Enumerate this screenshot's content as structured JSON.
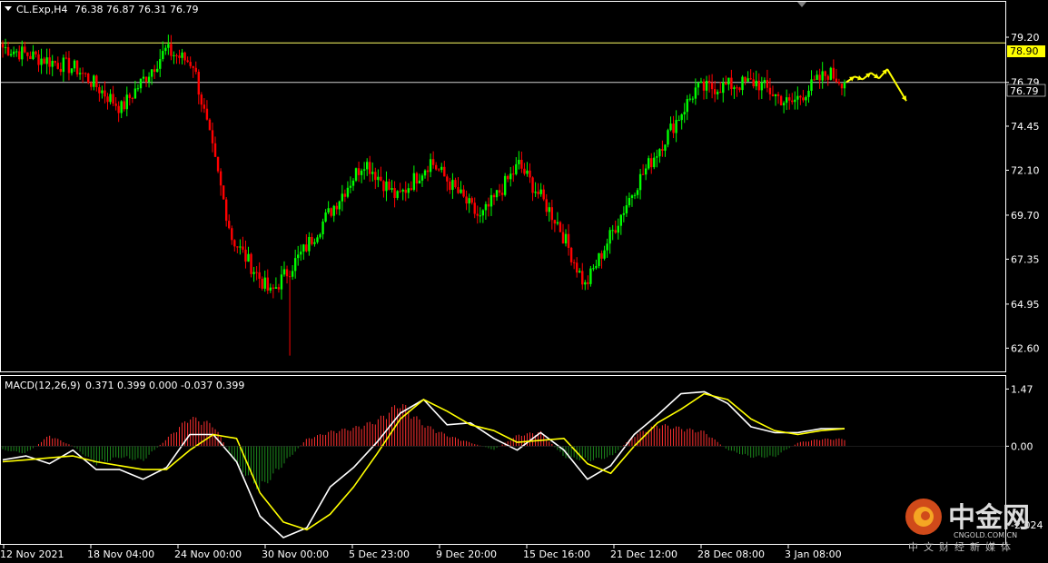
{
  "header": {
    "symbol_text": "CL.Exp,H4",
    "ohlc_text": "76.38 76.87 76.31 76.79"
  },
  "macd_header": {
    "label": "MACD(12,26,9)",
    "values_text": "0.371 0.399 0.000 -0.037 0.399"
  },
  "colors": {
    "background": "#000000",
    "bull_candle": "#00ff00",
    "bear_candle": "#ff0000",
    "grid_frame": "#ffffff",
    "level_line": "#ffff66",
    "macd_line": "#ffffff",
    "signal_line": "#ffff00",
    "hist_positive": "#ff3030",
    "hist_negative": "#1c8a1c",
    "arrow": "#ffff00"
  },
  "price_tags": {
    "level_top": "78.90",
    "current": "76.79"
  },
  "x_labels": [
    "12 Nov 2021",
    "18 Nov 04:00",
    "24 Nov 00:00",
    "30 Nov 00:00",
    "5 Dec 23:00",
    "9 Dec 20:00",
    "15 Dec 16:00",
    "21 Dec 12:00",
    "28 Dec 08:00",
    "3 Jan 08:00"
  ],
  "watermark": {
    "brand_cn": "中金网",
    "domain": "CNGOLD.COM.CN",
    "tagline_cn": "中文财经新媒体"
  },
  "chart_data": [
    {
      "type": "candlestick",
      "title": "CL.Exp,H4",
      "y_ticks": [
        "79.20",
        "76.79",
        "74.45",
        "72.10",
        "69.70",
        "67.35",
        "64.95",
        "62.60"
      ],
      "ylim": [
        61.6,
        80.8
      ],
      "horizontal_levels": [
        78.9,
        76.79
      ],
      "last_close": 76.79,
      "segments": [
        {
          "n": 28,
          "start": 78.7,
          "end": 77.5
        },
        {
          "n": 16,
          "start": 77.5,
          "end": 75.4
        },
        {
          "n": 16,
          "start": 75.4,
          "end": 78.5
        },
        {
          "n": 10,
          "start": 78.5,
          "end": 77.8
        },
        {
          "n": 14,
          "start": 77.8,
          "end": 68.5
        },
        {
          "n": 14,
          "start": 68.5,
          "end": 65.5
        },
        {
          "n": 12,
          "start": 65.5,
          "end": 67.8
        },
        {
          "n": 22,
          "start": 67.8,
          "end": 72.6
        },
        {
          "n": 12,
          "start": 72.6,
          "end": 70.6
        },
        {
          "n": 12,
          "start": 70.6,
          "end": 72.6
        },
        {
          "n": 18,
          "start": 72.6,
          "end": 69.5
        },
        {
          "n": 14,
          "start": 69.5,
          "end": 72.4
        },
        {
          "n": 14,
          "start": 72.4,
          "end": 69.3
        },
        {
          "n": 10,
          "start": 69.3,
          "end": 65.9
        },
        {
          "n": 18,
          "start": 65.9,
          "end": 71.2
        },
        {
          "n": 22,
          "start": 71.2,
          "end": 76.4
        },
        {
          "n": 22,
          "start": 76.4,
          "end": 76.8
        },
        {
          "n": 12,
          "start": 76.8,
          "end": 75.6
        },
        {
          "n": 14,
          "start": 75.6,
          "end": 77.3
        },
        {
          "n": 6,
          "start": 77.3,
          "end": 76.79
        }
      ],
      "low_spike": 62.2,
      "forecast_path": [
        76.8,
        77.1,
        76.95,
        77.3,
        77.0,
        77.5,
        75.8
      ]
    },
    {
      "type": "line",
      "title": "MACD(12,26,9)",
      "y_ticks": [
        "1.47",
        "0.00",
        "-2.024"
      ],
      "ylim": [
        -2.35,
        1.62
      ],
      "series": [
        {
          "name": "MACD",
          "color": "#ffffff",
          "values": [
            -0.35,
            -0.25,
            -0.45,
            -0.1,
            -0.6,
            -0.6,
            -0.85,
            -0.55,
            0.3,
            0.3,
            -0.4,
            -1.8,
            -2.35,
            -2.1,
            -1.05,
            -0.55,
            0.1,
            0.85,
            1.2,
            0.55,
            0.6,
            0.2,
            -0.1,
            0.35,
            -0.1,
            -0.85,
            -0.5,
            0.3,
            0.8,
            1.35,
            1.4,
            1.1,
            0.5,
            0.35,
            0.35,
            0.45,
            0.45
          ]
        },
        {
          "name": "Signal",
          "color": "#ffff00",
          "values": [
            -0.4,
            -0.35,
            -0.3,
            -0.25,
            -0.4,
            -0.5,
            -0.6,
            -0.6,
            -0.1,
            0.3,
            0.2,
            -1.2,
            -1.95,
            -2.15,
            -1.75,
            -1.05,
            -0.2,
            0.7,
            1.2,
            0.9,
            0.55,
            0.4,
            0.1,
            0.15,
            0.2,
            -0.45,
            -0.7,
            0.0,
            0.6,
            0.95,
            1.35,
            1.2,
            0.7,
            0.4,
            0.3,
            0.4,
            0.45
          ]
        }
      ],
      "histogram_profile": [
        -0.1,
        -0.2,
        0.3,
        0.0,
        -0.5,
        -0.3,
        -0.4,
        0.2,
        0.8,
        0.6,
        -0.5,
        -1.2,
        -0.5,
        0.2,
        0.4,
        0.5,
        0.7,
        1.2,
        0.6,
        0.3,
        0.1,
        -0.1,
        0.3,
        0.4,
        -0.3,
        -0.4,
        -0.3,
        0.3,
        0.6,
        0.5,
        0.4,
        -0.1,
        -0.3,
        -0.3,
        0.1,
        0.2,
        0.2
      ]
    }
  ]
}
